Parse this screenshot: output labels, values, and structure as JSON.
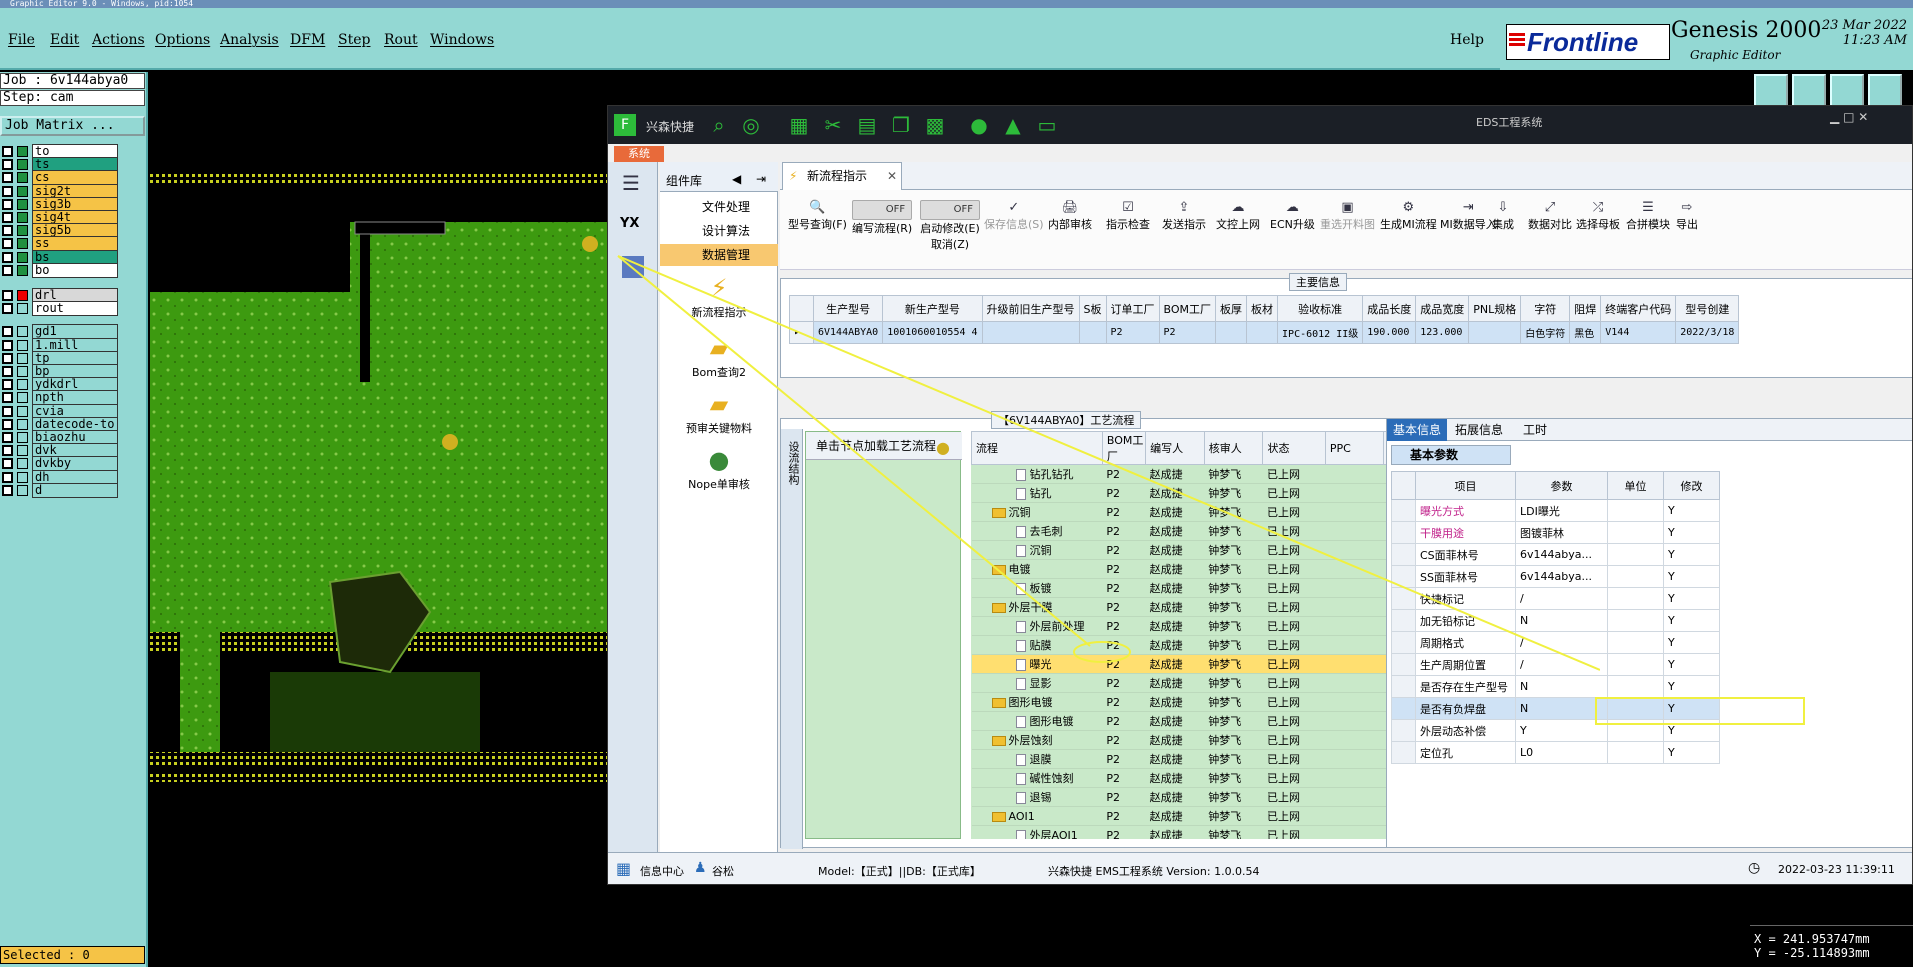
{
  "window_title": "Graphic Editor 9.0 - Windows, pid:1054",
  "menu": {
    "file": "File",
    "edit": "Edit",
    "actions": "Actions",
    "options": "Options",
    "analysis": "Analysis",
    "dfm": "DFM",
    "step": "Step",
    "rout": "Rout",
    "windows": "Windows",
    "help": "Help"
  },
  "brand": {
    "name": "Frontline",
    "product": "Genesis 2000",
    "subtitle": "Graphic Editor",
    "date": "23 Mar 2022",
    "time": "11:23 AM"
  },
  "job": {
    "job_line": "Job : 6v144abya0",
    "step_line": "Step: cam",
    "matrix_label": "Job Matrix ..."
  },
  "layers": [
    {
      "name": "to",
      "color": "#ffffff"
    },
    {
      "name": "ts",
      "color": "#20a080"
    },
    {
      "name": "cs",
      "color": "#f5c346"
    },
    {
      "name": "sig2t",
      "color": "#f5c346"
    },
    {
      "name": "sig3b",
      "color": "#f5c346"
    },
    {
      "name": "sig4t",
      "color": "#f5c346"
    },
    {
      "name": "sig5b",
      "color": "#f5c346"
    },
    {
      "name": "ss",
      "color": "#f5c346"
    },
    {
      "name": "bs",
      "color": "#20a080"
    },
    {
      "name": "bo",
      "color": "#ffffff"
    },
    {
      "name": "drl",
      "color": "#d8d8d8"
    },
    {
      "name": "rout",
      "color": "#ffffff"
    },
    {
      "name": "gd1",
      "color": "#93d8d3"
    },
    {
      "name": "1.mill",
      "color": "#93d8d3"
    },
    {
      "name": "tp",
      "color": "#93d8d3"
    },
    {
      "name": "bp",
      "color": "#93d8d3"
    },
    {
      "name": "ydkdrl",
      "color": "#93d8d3"
    },
    {
      "name": "npth",
      "color": "#93d8d3"
    },
    {
      "name": "cvia",
      "color": "#93d8d3"
    },
    {
      "name": "datecode-to",
      "color": "#93d8d3"
    },
    {
      "name": "biaozhu",
      "color": "#93d8d3"
    },
    {
      "name": "dvk",
      "color": "#93d8d3"
    },
    {
      "name": "dvkby",
      "color": "#93d8d3"
    },
    {
      "name": "dh",
      "color": "#93d8d3"
    },
    {
      "name": "d",
      "color": "#93d8d3"
    }
  ],
  "selected": "Selected : 0",
  "coords": {
    "x": "X = 241.953747mm",
    "y": "Y = -25.114893mm"
  },
  "eds": {
    "app_name": "兴森快捷",
    "title": "EDS工程系统",
    "system_tab": "系统",
    "side_label": "YX",
    "complib": {
      "title": "组件库",
      "items": [
        "文件处理",
        "设计算法",
        "数据管理"
      ],
      "big": [
        "新流程指示",
        "Bom查询2",
        "预审关键物料",
        "Nope单审核"
      ]
    },
    "tab": "新流程指示",
    "ribbon": [
      {
        "label": "型号查询(F)",
        "icon": "🔍"
      },
      {
        "label": "编写流程(R)",
        "toggle": "OFF"
      },
      {
        "label": "启动修改(E)",
        "sub": "取消(Z)",
        "toggle": "OFF"
      },
      {
        "label": "保存信息(S)",
        "icon": "✓",
        "dim": true
      },
      {
        "label": "内部审核",
        "icon": "🖨"
      },
      {
        "label": "指示检查",
        "icon": "☑"
      },
      {
        "label": "发送指示",
        "icon": "⇪"
      },
      {
        "label": "文控上网",
        "icon": "☁"
      },
      {
        "label": "ECN升级",
        "icon": "☁"
      },
      {
        "label": "重选开料图",
        "icon": "▣",
        "dim": true
      },
      {
        "label": "生成MI流程",
        "icon": "⚙"
      },
      {
        "label": "MI数据导入",
        "icon": "⇥"
      },
      {
        "label": "集成",
        "icon": "⇩"
      },
      {
        "label": "数据对比",
        "icon": "⤢"
      },
      {
        "label": "选择母板",
        "icon": "⤮"
      },
      {
        "label": "合拼模块",
        "icon": "☰"
      },
      {
        "label": "导出",
        "icon": "⇨"
      }
    ],
    "main_info": {
      "title": "主要信息",
      "headers": [
        "生产型号",
        "新生产型号",
        "升级前旧生产型号",
        "S板",
        "订单工厂",
        "BOM工厂",
        "板厚",
        "板材",
        "验收标准",
        "成品长度",
        "成品宽度",
        "PNL规格",
        "字符",
        "阻焊",
        "终端客户代码",
        "型号创建"
      ],
      "row": [
        "6V144ABYA0",
        "1001060010554 4",
        "",
        "",
        "P2",
        "P2",
        "",
        "",
        "IPC-6012 II级",
        "190.000",
        "123.000",
        "",
        "白色字符",
        "黑色",
        "V144",
        "2022/3/18"
      ]
    },
    "process": {
      "title": "【6V144ABYA0】工艺流程",
      "side_label": "设流结构",
      "node_hint": "单击节点加载工艺流程",
      "headers": [
        "流程",
        "BOM工厂",
        "编写人",
        "核审人",
        "状态",
        "PPC",
        ""
      ],
      "rows": [
        {
          "name": "钻孔钻孔",
          "type": "file",
          "level": 2,
          "bom": "P2",
          "writer": "赵成捷",
          "reviewer": "钟梦飞",
          "status": "已上网",
          "n": "1"
        },
        {
          "name": "钻孔",
          "type": "file",
          "level": 2,
          "bom": "P2",
          "writer": "赵成捷",
          "reviewer": "钟梦飞",
          "status": "已上网",
          "n": "1"
        },
        {
          "name": "沉铜",
          "type": "folder",
          "level": 1,
          "bom": "P2",
          "writer": "赵成捷",
          "reviewer": "钟梦飞",
          "status": "已上网",
          "n": "1"
        },
        {
          "name": "去毛刺",
          "type": "file",
          "level": 2,
          "bom": "P2",
          "writer": "赵成捷",
          "reviewer": "钟梦飞",
          "status": "已上网",
          "n": "1"
        },
        {
          "name": "沉铜",
          "type": "file",
          "level": 2,
          "bom": "P2",
          "writer": "赵成捷",
          "reviewer": "钟梦飞",
          "status": "已上网",
          "n": "1"
        },
        {
          "name": "电镀",
          "type": "folder",
          "level": 1,
          "bom": "P2",
          "writer": "赵成捷",
          "reviewer": "钟梦飞",
          "status": "已上网",
          "n": "1"
        },
        {
          "name": "板镀",
          "type": "file",
          "level": 2,
          "bom": "P2",
          "writer": "赵成捷",
          "reviewer": "钟梦飞",
          "status": "已上网",
          "n": "1"
        },
        {
          "name": "外层干膜",
          "type": "folder",
          "level": 1,
          "bom": "P2",
          "writer": "赵成捷",
          "reviewer": "钟梦飞",
          "status": "已上网",
          "n": "1"
        },
        {
          "name": "外层前处理",
          "type": "file",
          "level": 2,
          "bom": "P2",
          "writer": "赵成捷",
          "reviewer": "钟梦飞",
          "status": "已上网",
          "n": "1"
        },
        {
          "name": "贴膜",
          "type": "file",
          "level": 2,
          "bom": "P2",
          "writer": "赵成捷",
          "reviewer": "钟梦飞",
          "status": "已上网",
          "n": "1"
        },
        {
          "name": "曝光",
          "type": "file",
          "level": 2,
          "bom": "P2",
          "writer": "赵成捷",
          "reviewer": "钟梦飞",
          "status": "已上网",
          "n": "1",
          "selected": true
        },
        {
          "name": "显影",
          "type": "file",
          "level": 2,
          "bom": "P2",
          "writer": "赵成捷",
          "reviewer": "钟梦飞",
          "status": "已上网",
          "n": "1"
        },
        {
          "name": "图形电镀",
          "type": "folder",
          "level": 1,
          "bom": "P2",
          "writer": "赵成捷",
          "reviewer": "钟梦飞",
          "status": "已上网",
          "n": "1"
        },
        {
          "name": "图形电镀",
          "type": "file",
          "level": 2,
          "bom": "P2",
          "writer": "赵成捷",
          "reviewer": "钟梦飞",
          "status": "已上网",
          "n": "1"
        },
        {
          "name": "外层蚀刻",
          "type": "folder",
          "level": 1,
          "bom": "P2",
          "writer": "赵成捷",
          "reviewer": "钟梦飞",
          "status": "已上网",
          "n": "1"
        },
        {
          "name": "退膜",
          "type": "file",
          "level": 2,
          "bom": "P2",
          "writer": "赵成捷",
          "reviewer": "钟梦飞",
          "status": "已上网",
          "n": "1"
        },
        {
          "name": "碱性蚀刻",
          "type": "file",
          "level": 2,
          "bom": "P2",
          "writer": "赵成捷",
          "reviewer": "钟梦飞",
          "status": "已上网",
          "n": "1"
        },
        {
          "name": "退锡",
          "type": "file",
          "level": 2,
          "bom": "P2",
          "writer": "赵成捷",
          "reviewer": "钟梦飞",
          "status": "已上网",
          "n": "1"
        },
        {
          "name": "AOI1",
          "type": "folder",
          "level": 1,
          "bom": "P2",
          "writer": "赵成捷",
          "reviewer": "钟梦飞",
          "status": "已上网",
          "n": "1"
        },
        {
          "name": "外层AOI1",
          "type": "file",
          "level": 2,
          "bom": "P2",
          "writer": "赵成捷",
          "reviewer": "钟梦飞",
          "status": "已上网",
          "n": "1"
        }
      ]
    },
    "right": {
      "tabs": [
        "基本信息",
        "拓展信息",
        "工时"
      ],
      "section": "基本参数",
      "headers": [
        "项目",
        "参数",
        "单位",
        "修改"
      ],
      "rows": [
        {
          "item": "曝光方式",
          "param": "LDI曝光",
          "mod": "Y",
          "color": "#c0208a"
        },
        {
          "item": "干膜用途",
          "param": "图镀菲林",
          "mod": "Y",
          "color": "#c0208a"
        },
        {
          "item": "CS面菲林号",
          "param": "6v144abya...",
          "mod": "Y"
        },
        {
          "item": "SS面菲林号",
          "param": "6v144abya...",
          "mod": "Y"
        },
        {
          "item": "快捷标记",
          "param": "/",
          "mod": "Y"
        },
        {
          "item": "加无铅标记",
          "param": "N",
          "mod": "Y"
        },
        {
          "item": "周期格式",
          "param": "/",
          "mod": "Y"
        },
        {
          "item": "生产周期位置",
          "param": "/",
          "mod": "Y"
        },
        {
          "item": "是否存在生产型号",
          "param": "N",
          "mod": "Y"
        },
        {
          "item": "是否有负焊盘",
          "param": "N",
          "mod": "Y",
          "selected": true
        },
        {
          "item": "外层动态补偿",
          "param": "Y",
          "mod": "Y"
        },
        {
          "item": "定位孔",
          "param": "L0",
          "mod": "Y"
        }
      ]
    },
    "status": {
      "info": "信息中心",
      "user": "谷松",
      "model": "Model:【正式】||DB:【正式库】",
      "app": "兴森快捷 EMS工程系统 Version: 1.0.0.54",
      "datetime": "2022-03-23 11:39:11"
    }
  }
}
